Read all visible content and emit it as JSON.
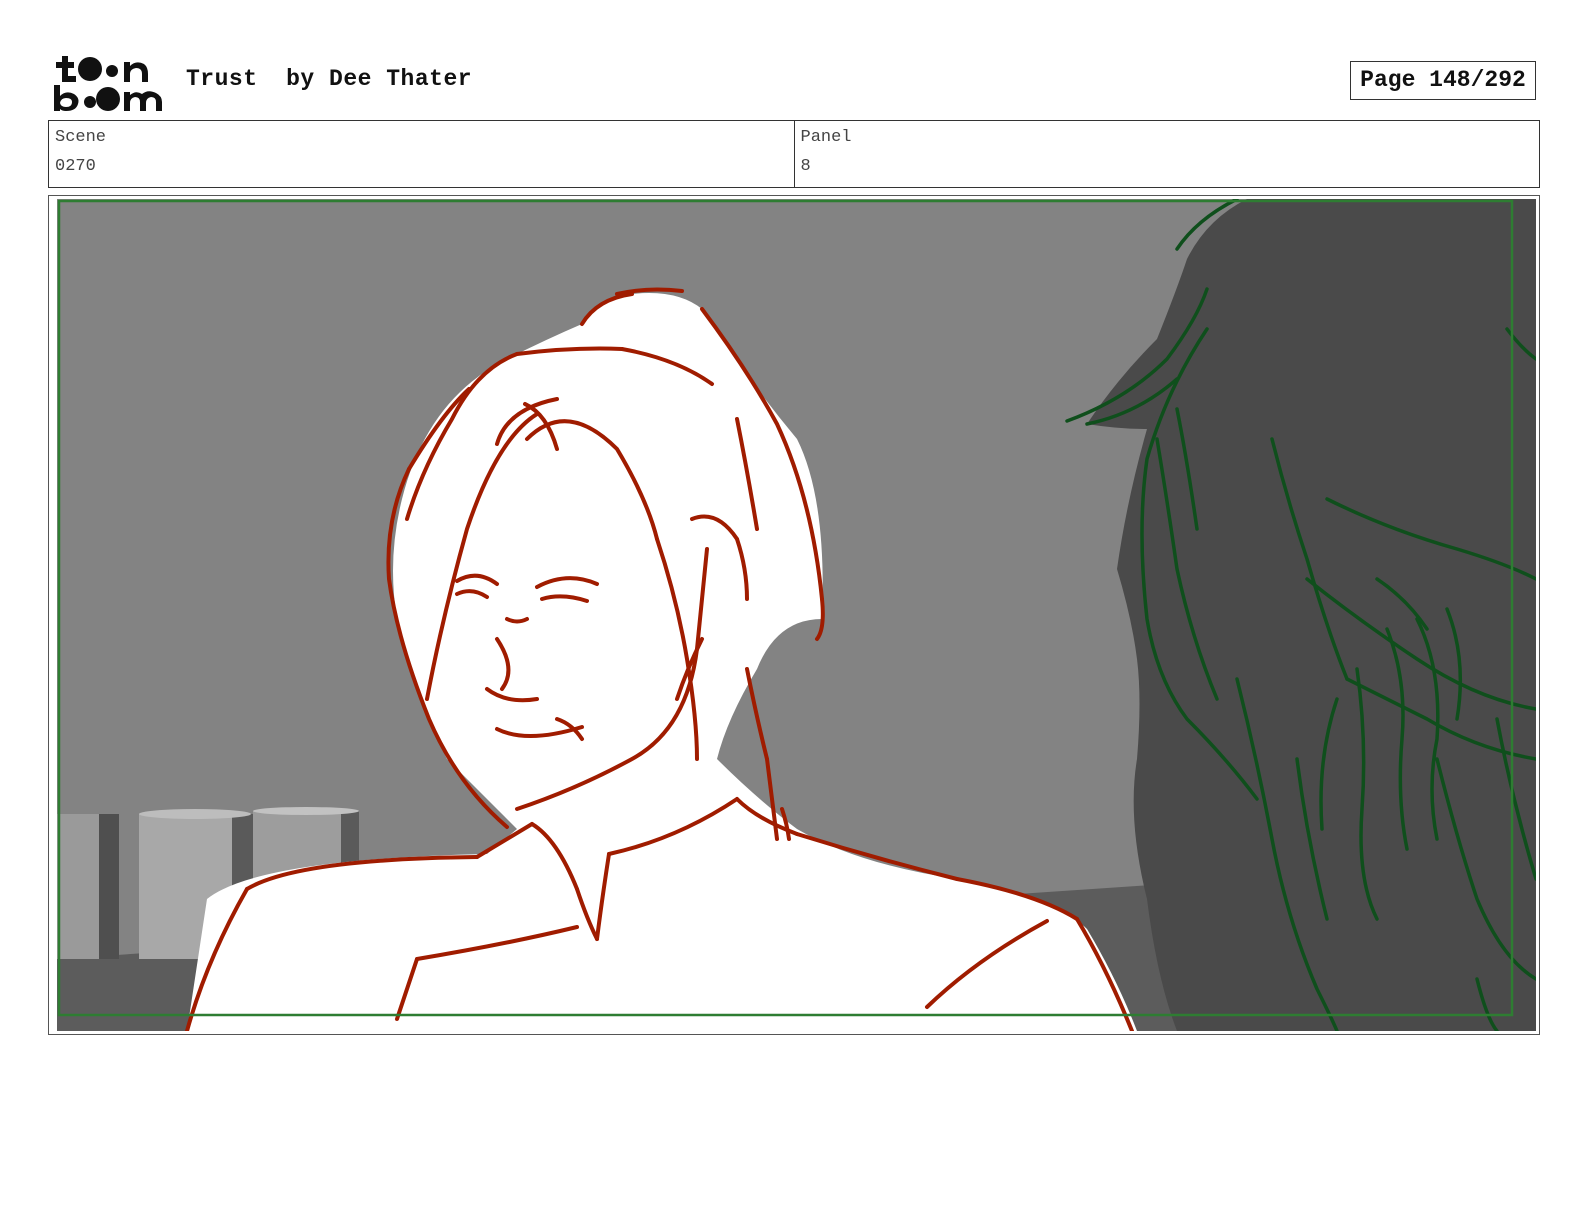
{
  "header": {
    "logo_top": "toon",
    "logo_bottom": "boom",
    "title": "Trust  by Dee Thater",
    "page": "Page 148/292"
  },
  "info": {
    "scene_label": "Scene",
    "scene_value": "0270",
    "panel_label": "Panel",
    "panel_value": "8"
  },
  "panel_image": {
    "colors": {
      "background": "#838383",
      "floor": "#5c5c5c",
      "foreground_figure_lines": "#a01c00",
      "background_figure_fill": "#4a4a4a",
      "background_figure_lines": "#0f4f1c",
      "safe_frame": "#2e7d32"
    }
  }
}
